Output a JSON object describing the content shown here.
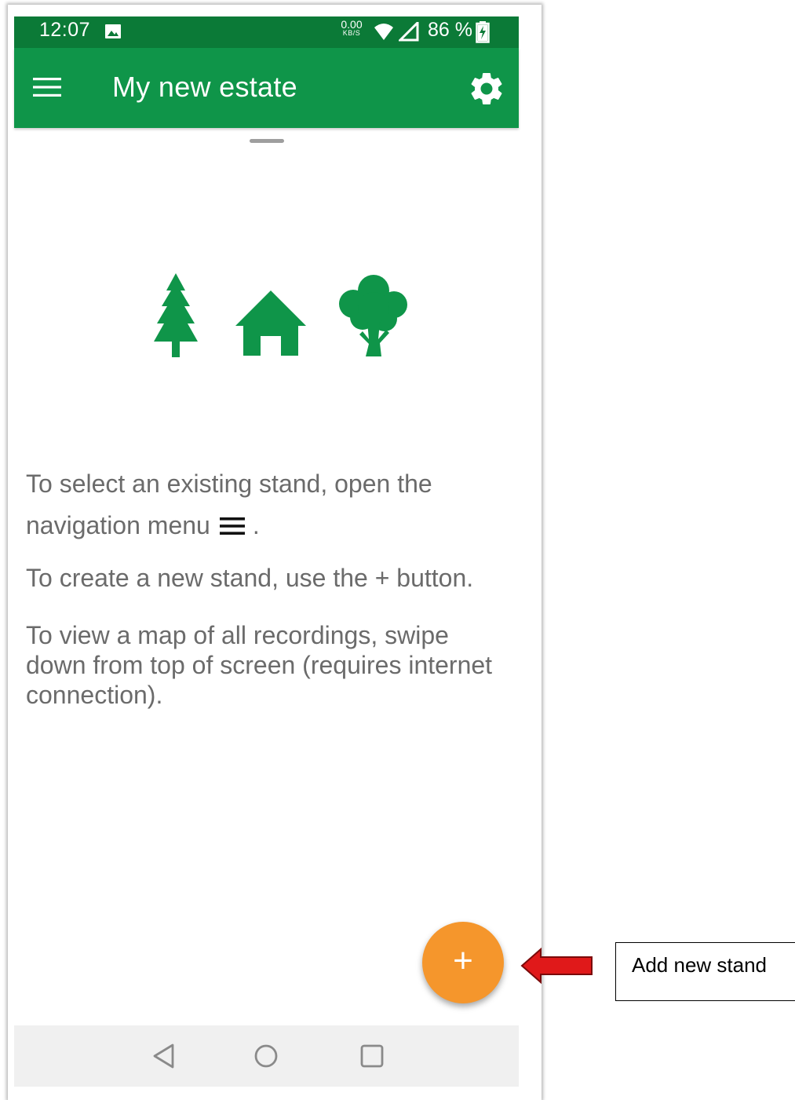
{
  "status_bar": {
    "time": "12:07",
    "network_speed_value": "0.00",
    "network_speed_unit": "KB/S",
    "battery_text": "86 %",
    "icons": [
      "gallery-icon",
      "wifi-icon",
      "signal-icon",
      "battery-charging-icon"
    ]
  },
  "app_bar": {
    "title": "My new estate",
    "menu_icon": "hamburger-menu-icon",
    "settings_icon": "gear-icon"
  },
  "illustration": {
    "icons": [
      "pine-tree-icon",
      "house-icon",
      "deciduous-tree-icon"
    ]
  },
  "instructions": {
    "select_text_before": "To select an existing stand, open the navigation menu",
    "select_text_after": ".",
    "create_text": "To create a new stand, use the + button.",
    "map_text": "To view a map of all recordings, swipe down from top of screen (requires internet connection)."
  },
  "fab": {
    "label": "+"
  },
  "nav_bar": {
    "icons": [
      "back-icon",
      "home-icon",
      "recents-icon"
    ]
  },
  "callout": {
    "text": "Add new stand"
  },
  "colors": {
    "status_bar": "#0b7a37",
    "app_bar": "#0f9549",
    "illustration_green": "#0f9549",
    "fab": "#f5962c",
    "text": "#6b6b6b",
    "arrow": "#e0191a"
  }
}
